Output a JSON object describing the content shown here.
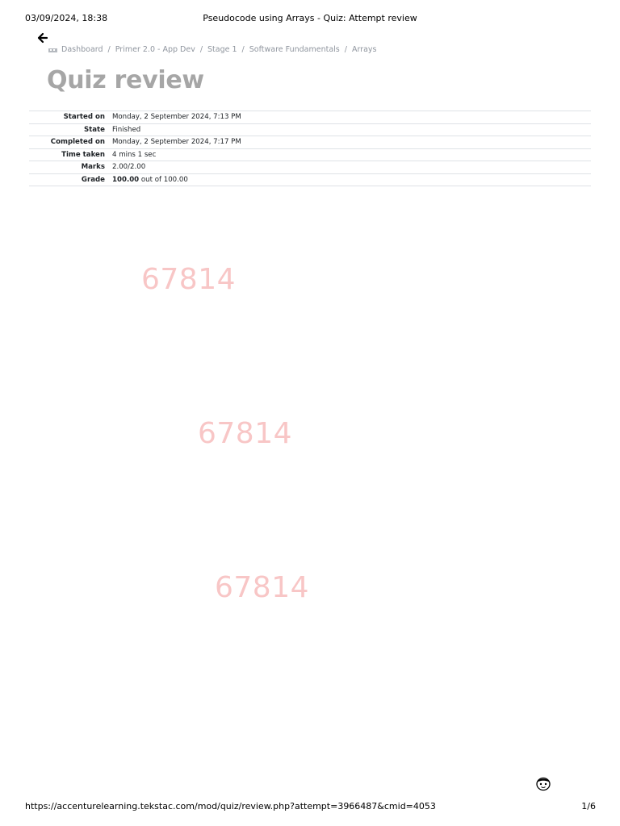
{
  "print_header": {
    "datetime": "03/09/2024, 18:38",
    "page_title": "Pseudocode using Arrays - Quiz: Attempt review"
  },
  "breadcrumb": [
    "Dashboard",
    "Primer 2.0 - App Dev",
    "Stage 1",
    "Software Fundamentals",
    "Arrays"
  ],
  "breadcrumb_separator": "/",
  "page_heading": "Quiz review",
  "summary": {
    "started_on_label": "Started on",
    "started_on_value": "Monday, 2 September 2024, 7:13 PM",
    "state_label": "State",
    "state_value": "Finished",
    "completed_on_label": "Completed on",
    "completed_on_value": "Monday, 2 September 2024, 7:17 PM",
    "time_taken_label": "Time taken",
    "time_taken_value": "4 mins 1 sec",
    "marks_label": "Marks",
    "marks_value": "2.00/2.00",
    "grade_label": "Grade",
    "grade_value_bold": "100.00",
    "grade_value_rest": " out of 100.00"
  },
  "watermark_text": "67814",
  "print_footer": {
    "url": "https://accenturelearning.tekstac.com/mod/quiz/review.php?attempt=3966487&cmid=4053",
    "page_number": "1/6"
  },
  "icons": {
    "back": "back-arrow-icon",
    "home": "home-icon",
    "chat": "chatbot-avatar-icon"
  },
  "colors": {
    "heading": "#a6a6a6",
    "breadcrumb": "#8f959e",
    "watermark": "#f08080",
    "table_border": "#dee2e6"
  }
}
